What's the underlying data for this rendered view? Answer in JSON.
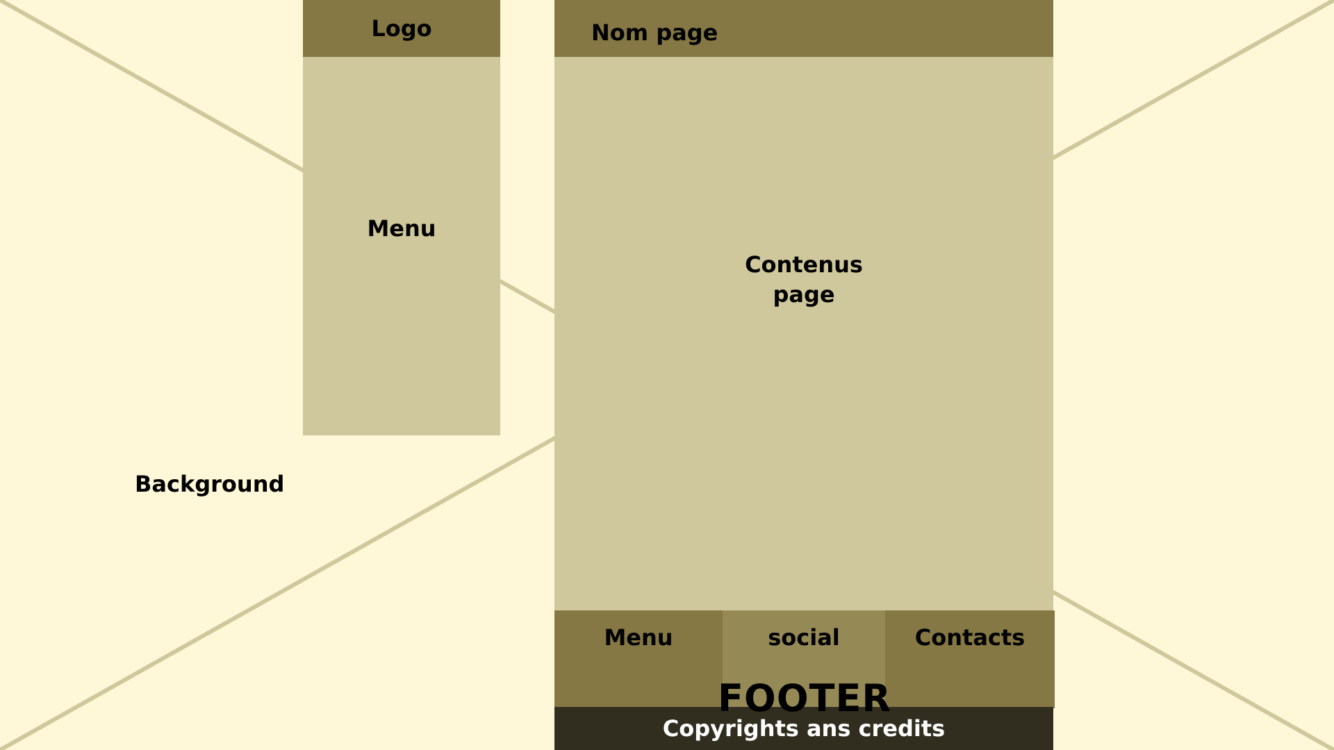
{
  "colors": {
    "background": "#fef8d8",
    "header_dark": "#857844",
    "panel_light": "#cfc89c",
    "footer_social": "#958956",
    "copyright_bar": "#312e20",
    "diagonal_lines": "#cfc89c"
  },
  "sidebar": {
    "logo_label": "Logo",
    "menu_label": "Menu"
  },
  "main": {
    "page_name_label": "Nom page",
    "content_label": "Contenus\npage"
  },
  "footer": {
    "menu_label": "Menu",
    "social_label": "social",
    "contacts_label": "Contacts",
    "footer_label": "FOOTER",
    "copyright_label": "Copyrights ans credits"
  },
  "background_label": "Background"
}
